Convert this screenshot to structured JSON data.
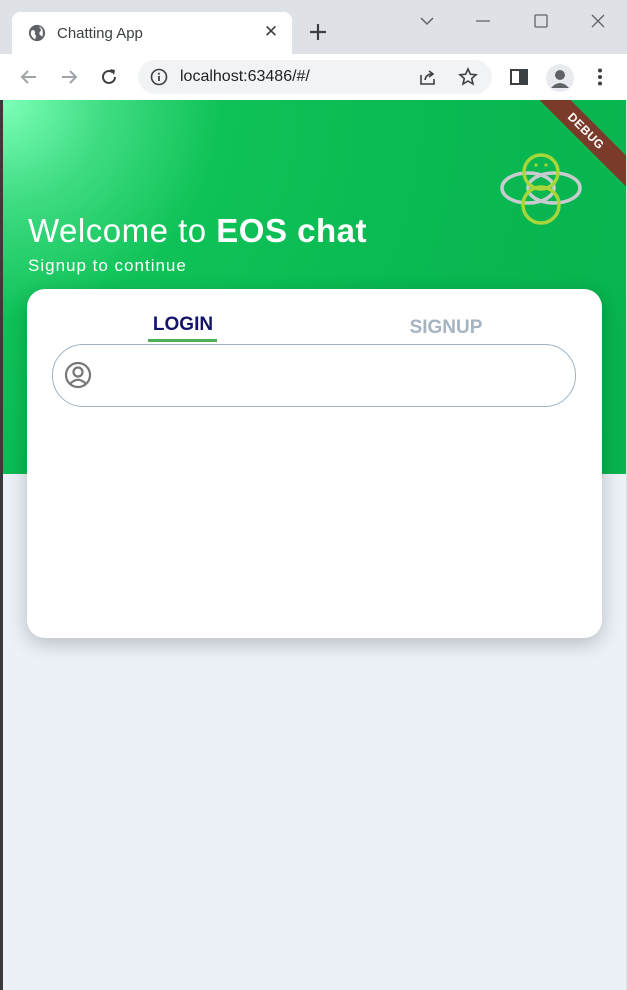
{
  "browser": {
    "tab_title": "Chatting App",
    "tab_close": "✕",
    "url": "localhost:63486/#/"
  },
  "page": {
    "debug_banner": "DEBUG",
    "welcome_prefix": "Welcome to ",
    "welcome_brand": "EOS chat",
    "subtitle": "Signup to continue",
    "tabs": {
      "login": "LOGIN",
      "signup": "SIGNUP"
    },
    "username_field": {
      "value": "",
      "placeholder": ""
    }
  },
  "colors": {
    "hero_green": "#08b34f",
    "login_tab": "#14136a",
    "login_underline": "#4caf50",
    "signup_tab": "#a5b4c0",
    "page_background": "#ecf1f8"
  }
}
